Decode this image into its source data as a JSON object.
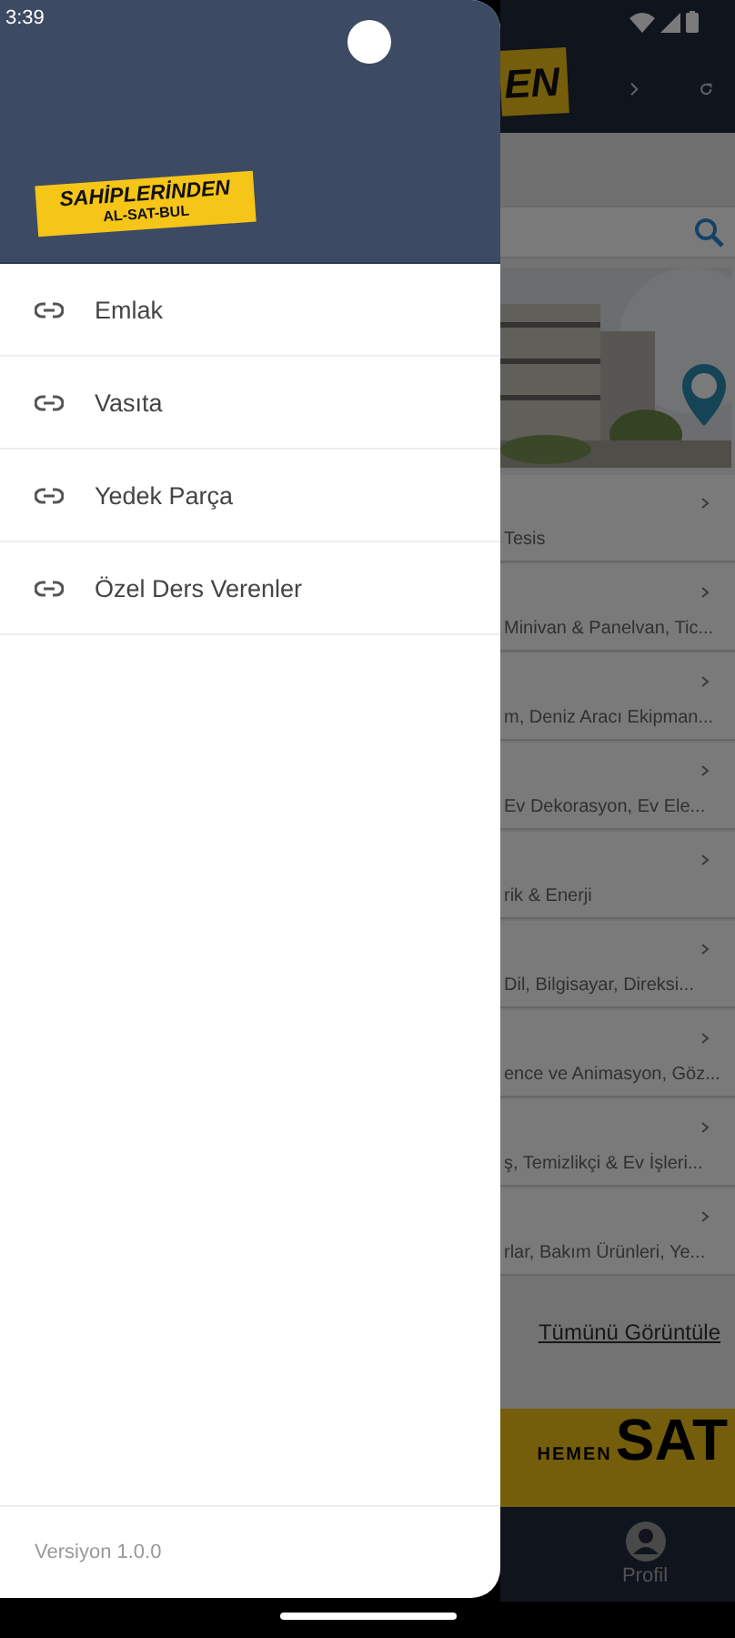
{
  "status_bar": {
    "time": "3:39"
  },
  "drawer": {
    "logo": {
      "line_1": "SAHİPLERİNDEN",
      "line_2": "AL-SAT-BUL"
    },
    "items": [
      {
        "label": "Emlak"
      },
      {
        "label": "Vasıta"
      },
      {
        "label": "Yedek Parça"
      },
      {
        "label": "Özel Ders Verenler"
      }
    ],
    "version": "Versiyon 1.0.0"
  },
  "background": {
    "logo_fragment": "EN",
    "category_rows": [
      {
        "text": "Tesis"
      },
      {
        "text": "Minivan & Panelvan, Tic..."
      },
      {
        "text": "m, Deniz Aracı Ekipman..."
      },
      {
        "text": "Ev Dekorasyon, Ev Ele..."
      },
      {
        "text": "rik & Enerji"
      },
      {
        "text": "Dil, Bilgisayar, Direksi..."
      },
      {
        "text": "ence ve Animasyon, Göz..."
      },
      {
        "text": "ş, Temizlikçi & Ev İşleri..."
      },
      {
        "text": "rlar, Bakım Ürünleri, Ye..."
      }
    ],
    "view_all_link": "Tümünü Görüntüle",
    "promo_banner": {
      "word_1": "HEMEN",
      "word_2": "SAT"
    },
    "bottom_nav": {
      "label": "Profil"
    }
  }
}
